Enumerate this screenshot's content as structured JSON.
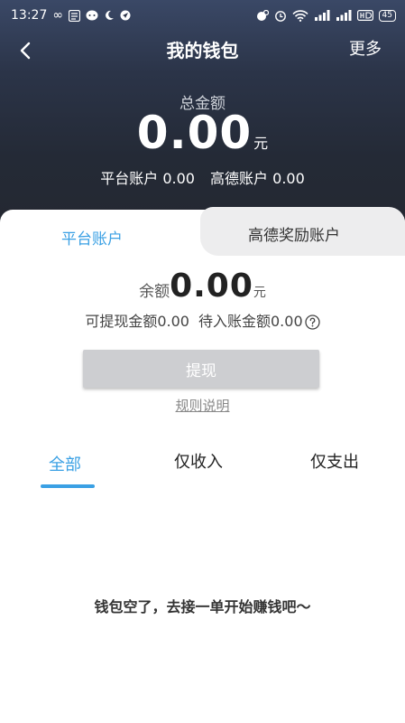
{
  "status_bar": {
    "time": "13:27",
    "battery": "45"
  },
  "nav": {
    "title": "我的钱包",
    "more": "更多"
  },
  "summary": {
    "total_label": "总金额",
    "total_amount": "0.00",
    "unit": "元",
    "platform_account": "平台账户 0.00",
    "gaode_account": "高德账户 0.00"
  },
  "tabs": {
    "active": "平台账户",
    "inactive": "高德奖励账户"
  },
  "balance": {
    "label": "余额",
    "amount": "0.00",
    "unit": "元"
  },
  "withdraw_info": {
    "withdrawable": "可提现金额0.00",
    "pending": "待入账金额0.00"
  },
  "withdraw_button": "提现",
  "rules_link": "规则说明",
  "filters": {
    "all": "全部",
    "income": "仅收入",
    "expense": "仅支出"
  },
  "empty_message": "钱包空了，去接一单开始赚钱吧～",
  "colors": {
    "accent": "#3aa0e4",
    "header_bg": "#23272f",
    "button_disabled": "#cdced1"
  }
}
